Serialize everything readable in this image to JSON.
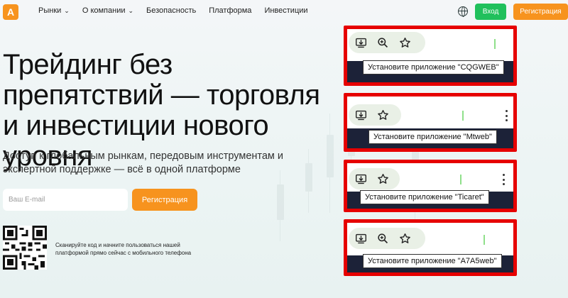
{
  "nav": {
    "logo": "A",
    "items": [
      {
        "label": "Рынки",
        "dropdown": true
      },
      {
        "label": "О компании",
        "dropdown": true
      },
      {
        "label": "Безопасность",
        "dropdown": false
      },
      {
        "label": "Платформа",
        "dropdown": false
      },
      {
        "label": "Инвестиции",
        "dropdown": false
      }
    ],
    "login": "Вход",
    "register": "Регистрация"
  },
  "hero": {
    "title": "Трейдинг без препятствий — торговля и инвестиции нового уровня",
    "subtitle": "Доступ к глобальным рынкам, передовым инструментам и экспертной поддержке — всё в одной платформе",
    "email_placeholder": "Ваш E-mail",
    "register_button": "Регистрация",
    "qr_text": "Сканируйте код и начните пользоваться нашей платформой прямо сейчас с мобильного телефона"
  },
  "popups": [
    {
      "tooltip": "Установите приложение \"CQGWEB\"",
      "icons": [
        "install-icon",
        "zoom-icon",
        "star-icon"
      ]
    },
    {
      "tooltip": "Установите приложение \"Mtweb\"",
      "icons": [
        "install-icon",
        "star-icon"
      ]
    },
    {
      "tooltip": "Установите приложение \"Ticaret\"",
      "icons": [
        "install-icon",
        "star-icon"
      ]
    },
    {
      "tooltip": "Установите приложение \"A7A5web\"",
      "icons": [
        "install-icon",
        "zoom-icon",
        "star-icon"
      ]
    }
  ],
  "colors": {
    "accent": "#f7931e",
    "login": "#20c05c",
    "highlight": "#e60000"
  }
}
